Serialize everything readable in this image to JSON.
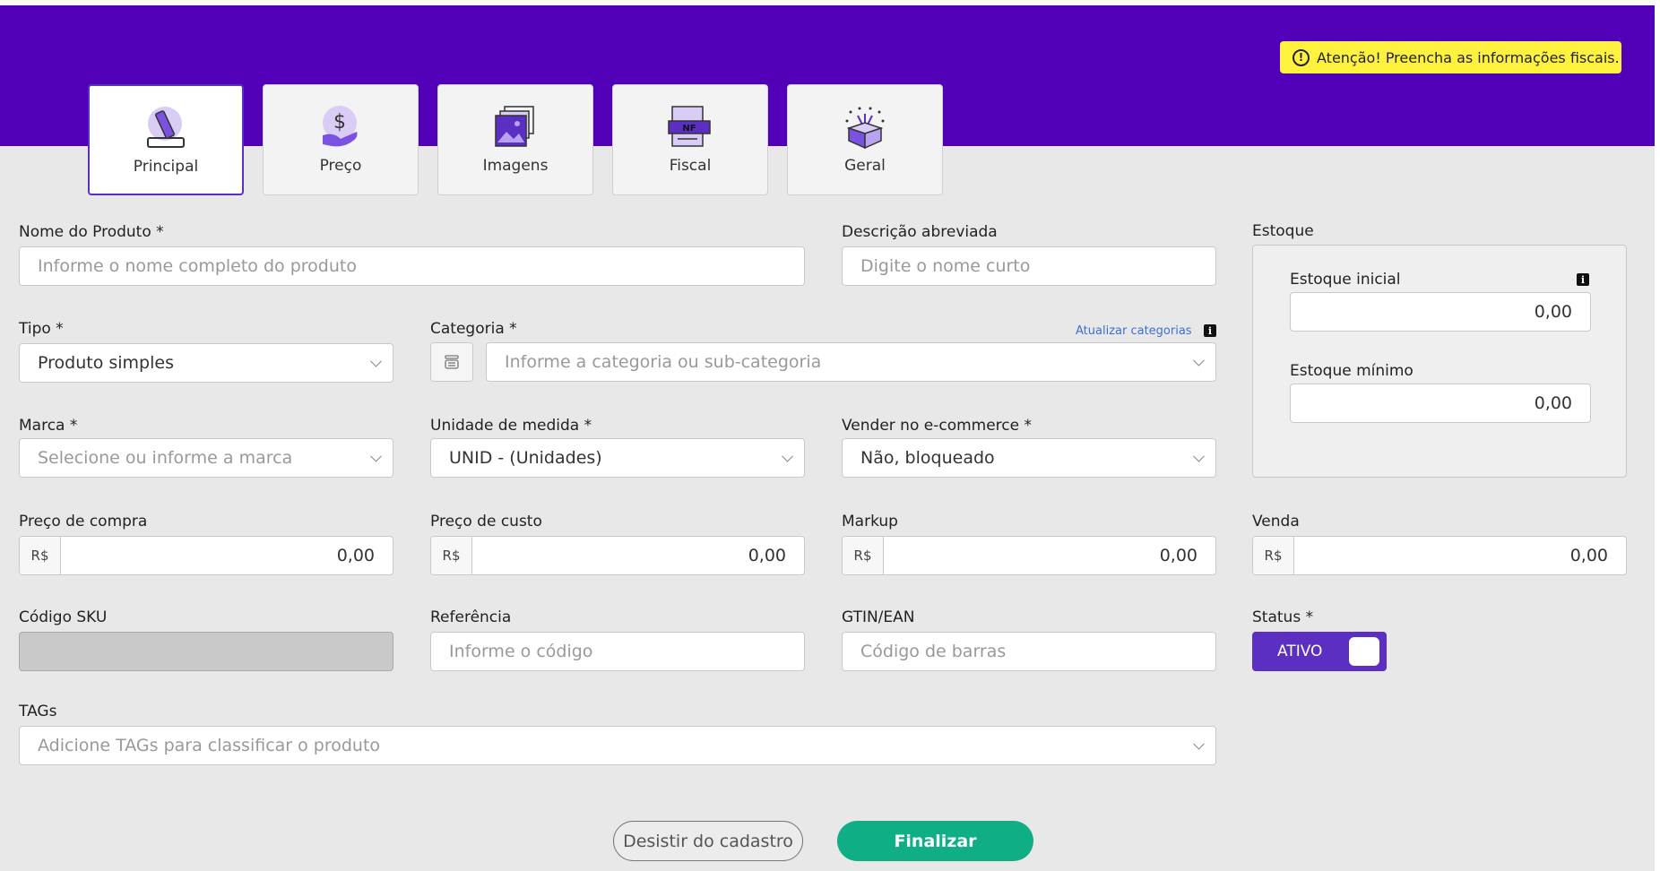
{
  "alert": {
    "text": "Atenção! Preencha as informações fiscais."
  },
  "tabs": [
    {
      "label": "Principal",
      "icon": "pencil-icon",
      "active": true
    },
    {
      "label": "Preço",
      "icon": "price-hand-icon"
    },
    {
      "label": "Imagens",
      "icon": "images-icon"
    },
    {
      "label": "Fiscal",
      "icon": "invoice-nf-icon",
      "badge": "NF"
    },
    {
      "label": "Geral",
      "icon": "gift-box-icon"
    }
  ],
  "form": {
    "product_name": {
      "label": "Nome do Produto *",
      "placeholder": "Informe o nome completo do produto"
    },
    "short_desc": {
      "label": "Descrição abreviada",
      "placeholder": "Digite o nome curto"
    },
    "type": {
      "label": "Tipo *",
      "value": "Produto simples"
    },
    "category": {
      "label": "Categoria *",
      "placeholder": "Informe a categoria ou sub-categoria",
      "refresh_link": "Atualizar categorias"
    },
    "brand": {
      "label": "Marca *",
      "placeholder": "Selecione ou informe a marca"
    },
    "unit": {
      "label": "Unidade de medida *",
      "value": "UNID - (Unidades)"
    },
    "ecommerce": {
      "label": "Vender no e-commerce *",
      "value": "Não, bloqueado"
    },
    "purchase_price": {
      "label": "Preço de compra",
      "prefix": "R$",
      "value": "0,00"
    },
    "cost_price": {
      "label": "Preço de custo",
      "prefix": "R$",
      "value": "0,00"
    },
    "markup": {
      "label": "Markup",
      "prefix": "R$",
      "value": "0,00"
    },
    "sale": {
      "label": "Venda",
      "prefix": "R$",
      "value": "0,00"
    },
    "sku": {
      "label": "Código SKU",
      "value": ""
    },
    "reference": {
      "label": "Referência",
      "placeholder": "Informe o código"
    },
    "gtin": {
      "label": "GTIN/EAN",
      "placeholder": "Código de barras"
    },
    "status": {
      "label": "Status *",
      "value": "ATIVO"
    },
    "tags": {
      "label": "TAGs",
      "placeholder": "Adicione TAGs para classificar o produto"
    }
  },
  "stock": {
    "title": "Estoque",
    "initial": {
      "label": "Estoque inicial",
      "value": "0,00"
    },
    "minimum": {
      "label": "Estoque mínimo",
      "value": "0,00"
    }
  },
  "info_icon": "i",
  "buttons": {
    "cancel": "Desistir do cadastro",
    "finish": "Finalizar"
  },
  "colors": {
    "primary": "#5100b7",
    "accent": "#5a2fc2",
    "alert": "#fff23f",
    "success": "#0fae85",
    "background": "#e8e8e8"
  }
}
